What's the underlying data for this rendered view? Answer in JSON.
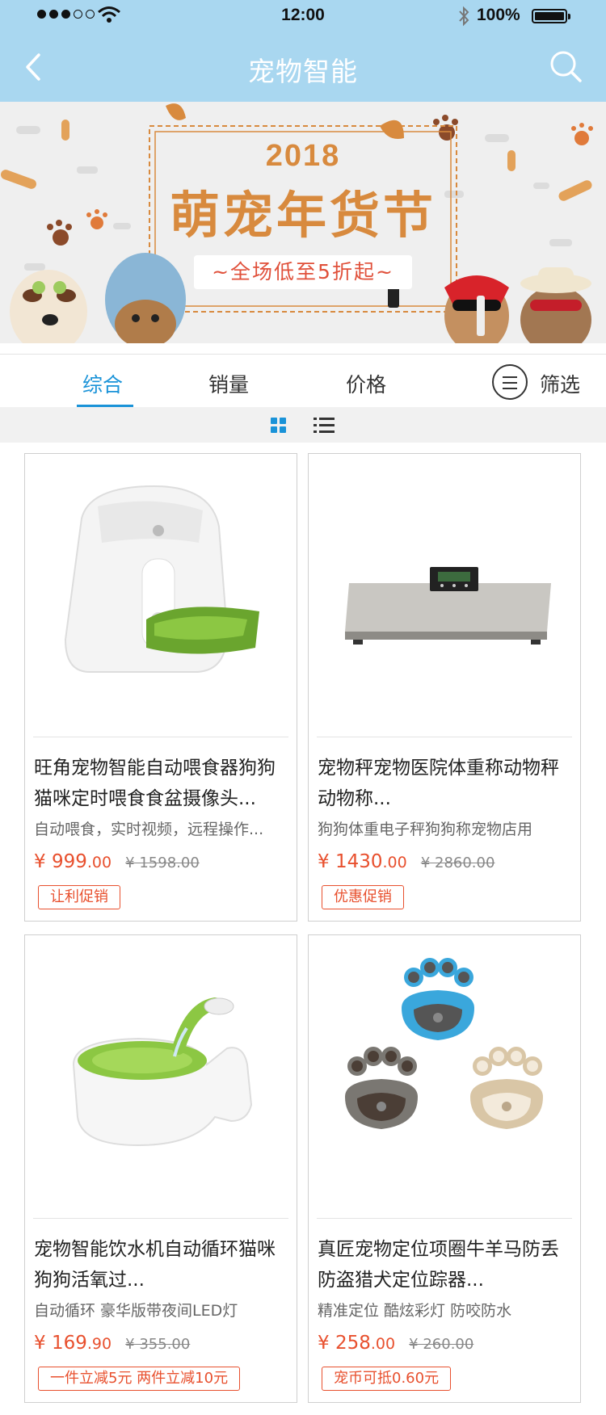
{
  "status_bar": {
    "time": "12:00",
    "battery": "100%"
  },
  "nav": {
    "title": "宠物智能"
  },
  "banner": {
    "year": "2018",
    "title": "萌宠年货节",
    "subtitle": "~全场低至5折起~"
  },
  "sort_tabs": [
    {
      "label": "综合",
      "active": true
    },
    {
      "label": "销量",
      "active": false
    },
    {
      "label": "价格",
      "active": false
    }
  ],
  "filter_label": "筛选",
  "products": [
    {
      "title": "旺角宠物智能自动喂食器狗狗猫咪定时喂食食盆摄像头...",
      "desc": "自动喂食，实时视频，远程操作...",
      "price_symbol": "¥",
      "price_int": "999",
      "price_dec": ".00",
      "old_price": "¥ 1598.00",
      "promo": "让利促销",
      "icon": "pet-feeder-image"
    },
    {
      "title": "宠物秤宠物医院体重称动物秤动物称...",
      "desc": "狗狗体重电子秤狗狗称宠物店用",
      "price_symbol": "¥",
      "price_int": "1430",
      "price_dec": ".00",
      "old_price": "¥ 2860.00",
      "promo": "优惠促销",
      "icon": "pet-scale-image"
    },
    {
      "title": "宠物智能饮水机自动循环猫咪狗狗活氧过...",
      "desc": "自动循环 豪华版带夜间LED灯",
      "price_symbol": "¥",
      "price_int": "169",
      "price_dec": ".90",
      "old_price": "¥ 355.00",
      "promo": "一件立减5元 两件立减10元",
      "icon": "water-fountain-image"
    },
    {
      "title": "真匠宠物定位项圈牛羊马防丢防盗猎犬定位踪器...",
      "desc": "精准定位 酷炫彩灯  防咬防水",
      "price_symbol": "¥",
      "price_int": "258",
      "price_dec": ".00",
      "old_price": "¥ 260.00",
      "promo": "宠币可抵0.60元",
      "icon": "gps-tracker-image"
    }
  ],
  "colors": {
    "nav": "#a9d7f0",
    "accent": "#1a93d8",
    "price": "#e8502e",
    "banner_text": "#d88a3e"
  }
}
